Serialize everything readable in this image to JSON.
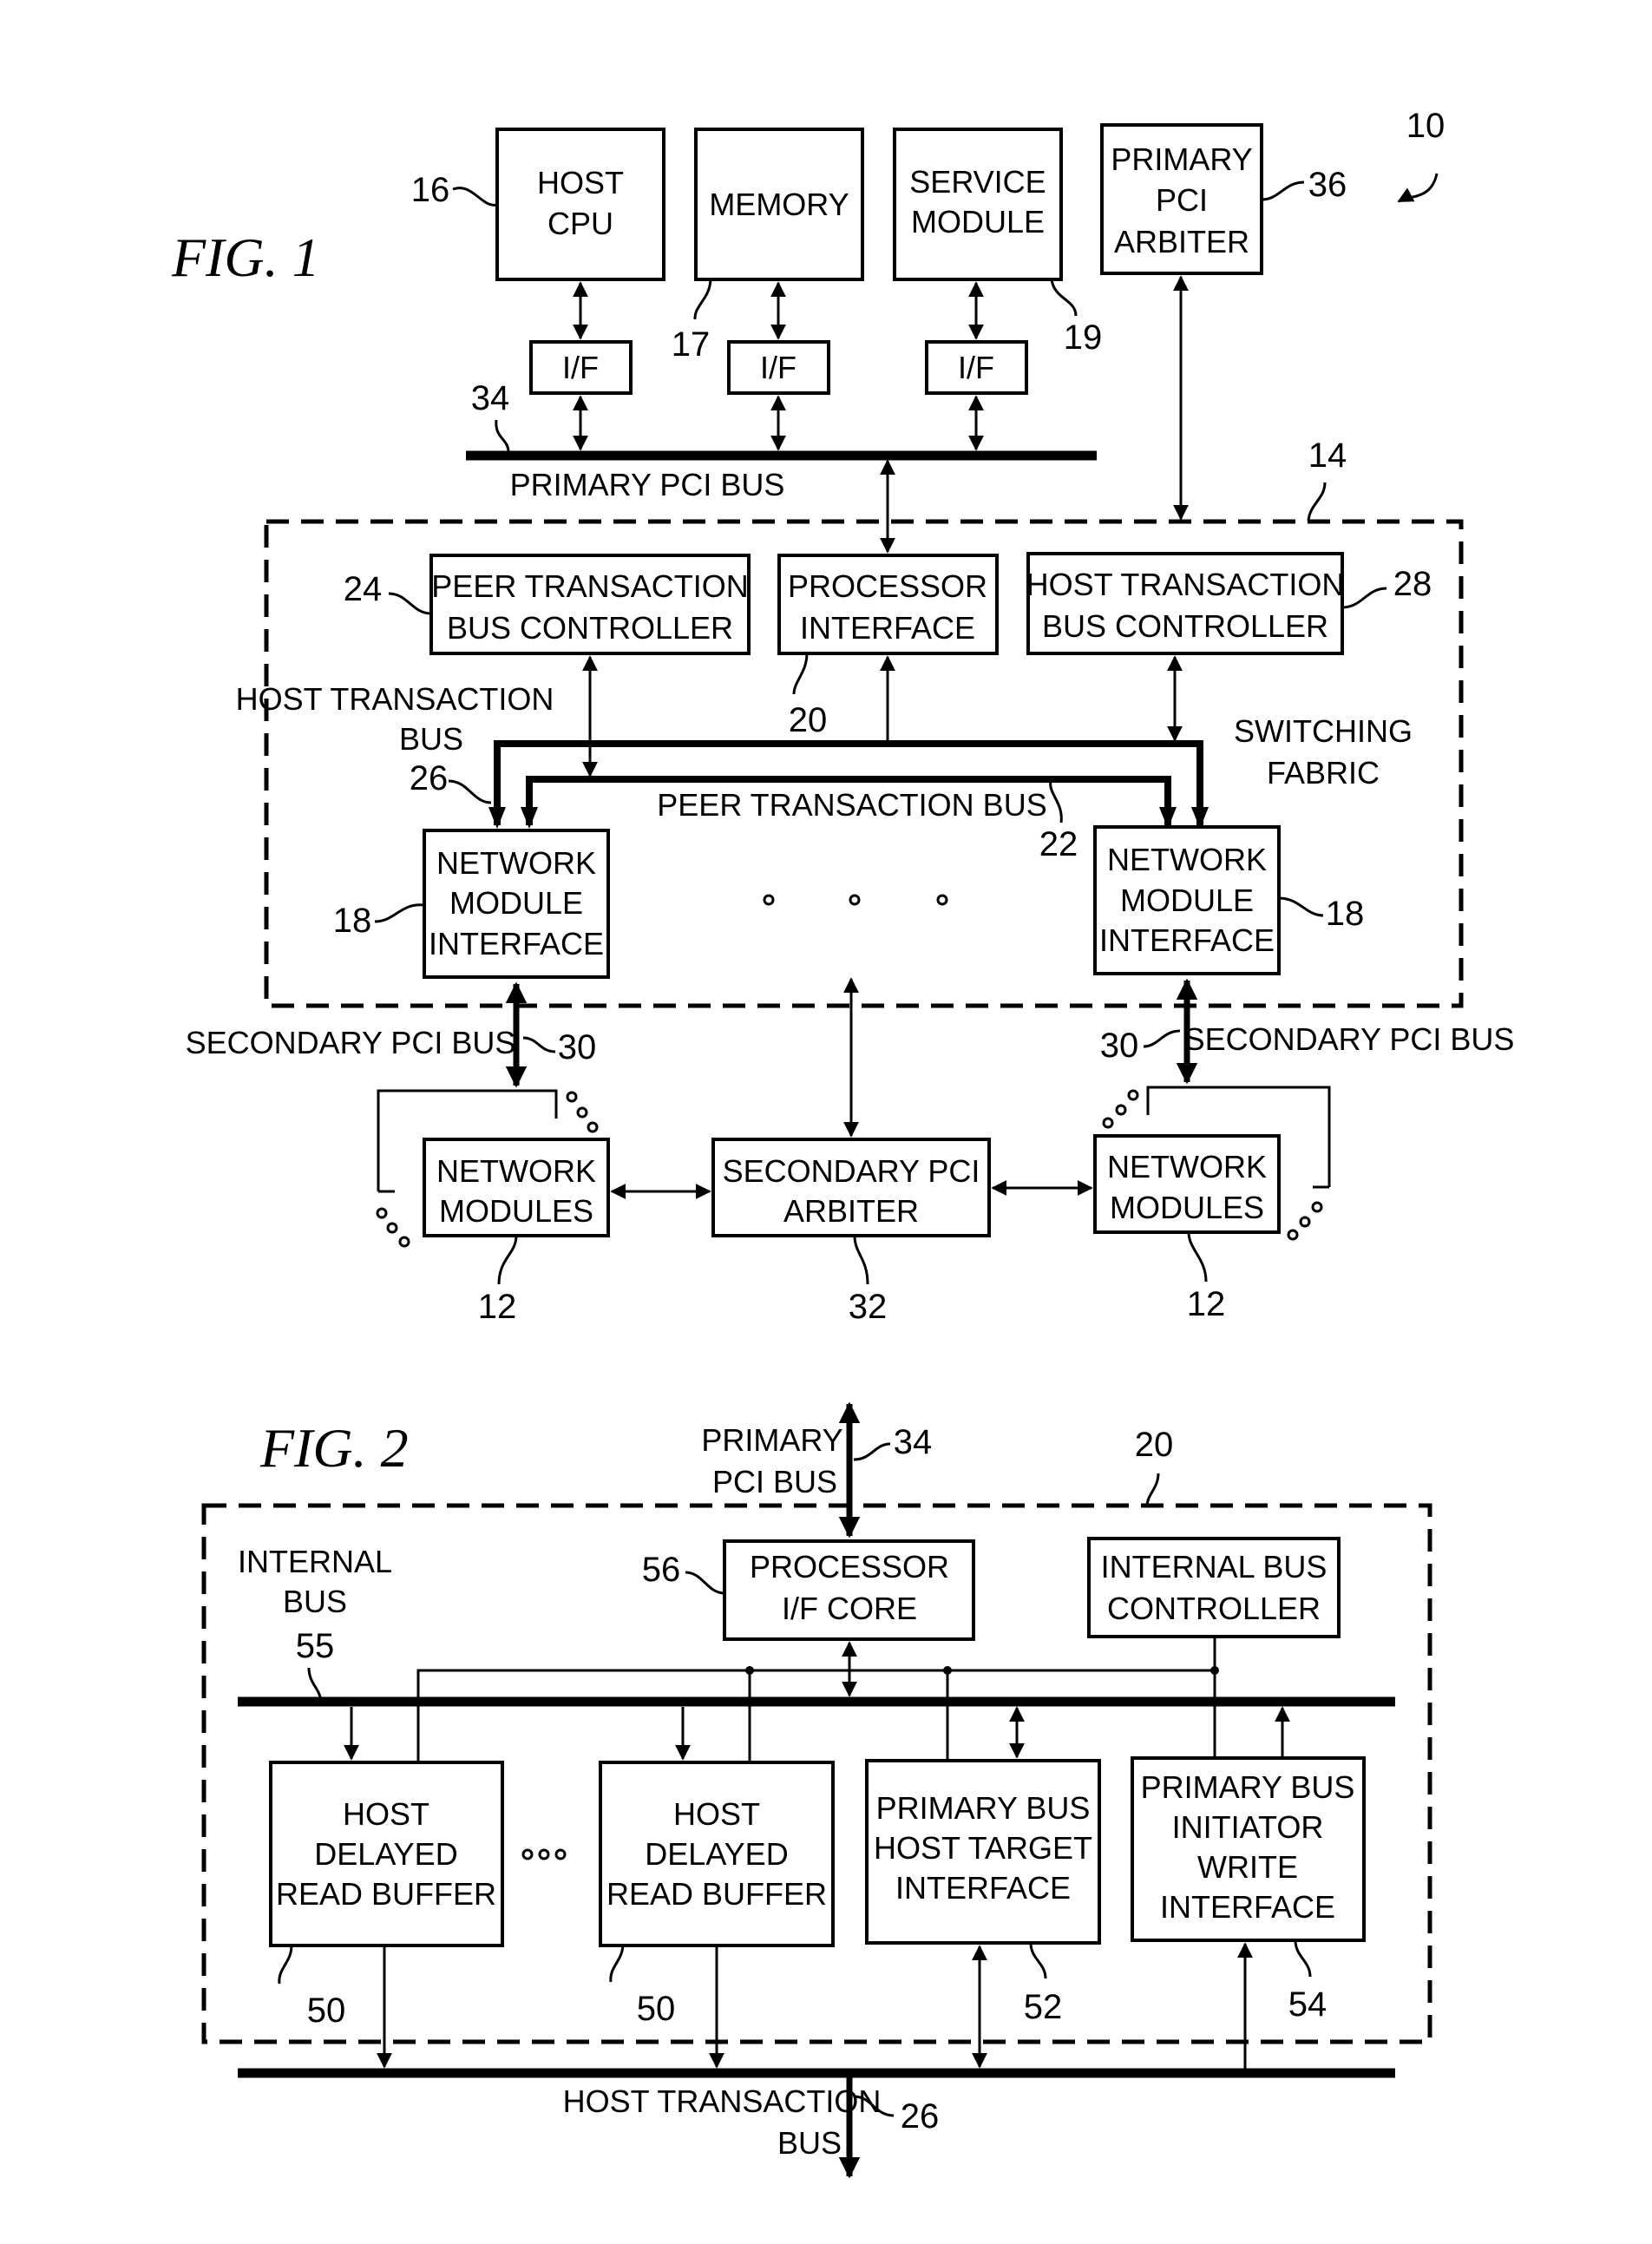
{
  "fig1": {
    "title": "FIG.  1",
    "system_ref": "10",
    "blocks": {
      "host_cpu": {
        "lines": [
          "HOST",
          "CPU"
        ],
        "ref": "16"
      },
      "memory": {
        "lines": [
          "MEMORY"
        ],
        "ref": "17"
      },
      "service_module": {
        "lines": [
          "SERVICE",
          "MODULE"
        ],
        "ref": "19"
      },
      "primary_pci_arbiter": {
        "lines": [
          "PRIMARY",
          "PCI",
          "ARBITER"
        ],
        "ref": "36"
      },
      "if_label": "I/F",
      "peer_tbc": {
        "lines": [
          "PEER  TRANSACTION",
          "BUS  CONTROLLER"
        ],
        "ref": "24"
      },
      "processor_interface": {
        "lines": [
          "PROCESSOR",
          "INTERFACE"
        ],
        "ref": "20"
      },
      "host_tbc": {
        "lines": [
          "HOST  TRANSACTION",
          "BUS  CONTROLLER"
        ],
        "ref": "28"
      },
      "nmi_left": {
        "lines": [
          "NETWORK",
          "MODULE",
          "INTERFACE"
        ],
        "ref": "18"
      },
      "nmi_right": {
        "lines": [
          "NETWORK",
          "MODULE",
          "INTERFACE"
        ],
        "ref": "18"
      },
      "nm_left": {
        "lines": [
          "NETWORK",
          "MODULES"
        ],
        "ref": "12"
      },
      "secondary_arbiter": {
        "lines": [
          "SECONDARY  PCI",
          "ARBITER"
        ],
        "ref": "32"
      },
      "nm_right": {
        "lines": [
          "NETWORK",
          "MODULES"
        ],
        "ref": "12"
      }
    },
    "labels": {
      "primary_pci_bus": "PRIMARY  PCI  BUS",
      "primary_pci_bus_ref": "34",
      "switching_fabric": [
        "SWITCHING",
        "FABRIC"
      ],
      "switching_fabric_ref": "14",
      "host_transaction_bus": [
        "HOST  TRANSACTION",
        "BUS"
      ],
      "host_transaction_bus_ref": "26",
      "peer_transaction_bus": "PEER  TRANSACTION  BUS",
      "peer_transaction_bus_ref": "22",
      "secondary_pci_bus_left": "SECONDARY  PCI  BUS",
      "secondary_pci_bus_right": "SECONDARY  PCI  BUS",
      "secondary_pci_bus_ref": "30"
    }
  },
  "fig2": {
    "title": "FIG.  2",
    "container_ref": "20",
    "blocks": {
      "processor_if_core": {
        "lines": [
          "PROCESSOR",
          "I/F  CORE"
        ],
        "ref": "56"
      },
      "internal_bus_controller": {
        "lines": [
          "INTERNAL  BUS",
          "CONTROLLER"
        ]
      },
      "hdrb_1": {
        "lines": [
          "HOST",
          "DELAYED",
          "READ  BUFFER"
        ],
        "ref": "50"
      },
      "hdrb_2": {
        "lines": [
          "HOST",
          "DELAYED",
          "READ  BUFFER"
        ],
        "ref": "50"
      },
      "pb_host_target": {
        "lines": [
          "PRIMARY  BUS",
          "HOST  TARGET",
          "INTERFACE"
        ],
        "ref": "52"
      },
      "pb_initiator_write": {
        "lines": [
          "PRIMARY  BUS",
          "INITIATOR",
          "WRITE",
          "INTERFACE"
        ],
        "ref": "54"
      }
    },
    "labels": {
      "primary_pci_bus": [
        "PRIMARY",
        "PCI  BUS"
      ],
      "primary_pci_bus_ref": "34",
      "internal_bus": [
        "INTERNAL",
        "BUS"
      ],
      "internal_bus_ref": "55",
      "host_transaction_bus": [
        "HOST  TRANSACTION",
        "BUS"
      ],
      "host_transaction_bus_ref": "26"
    }
  }
}
